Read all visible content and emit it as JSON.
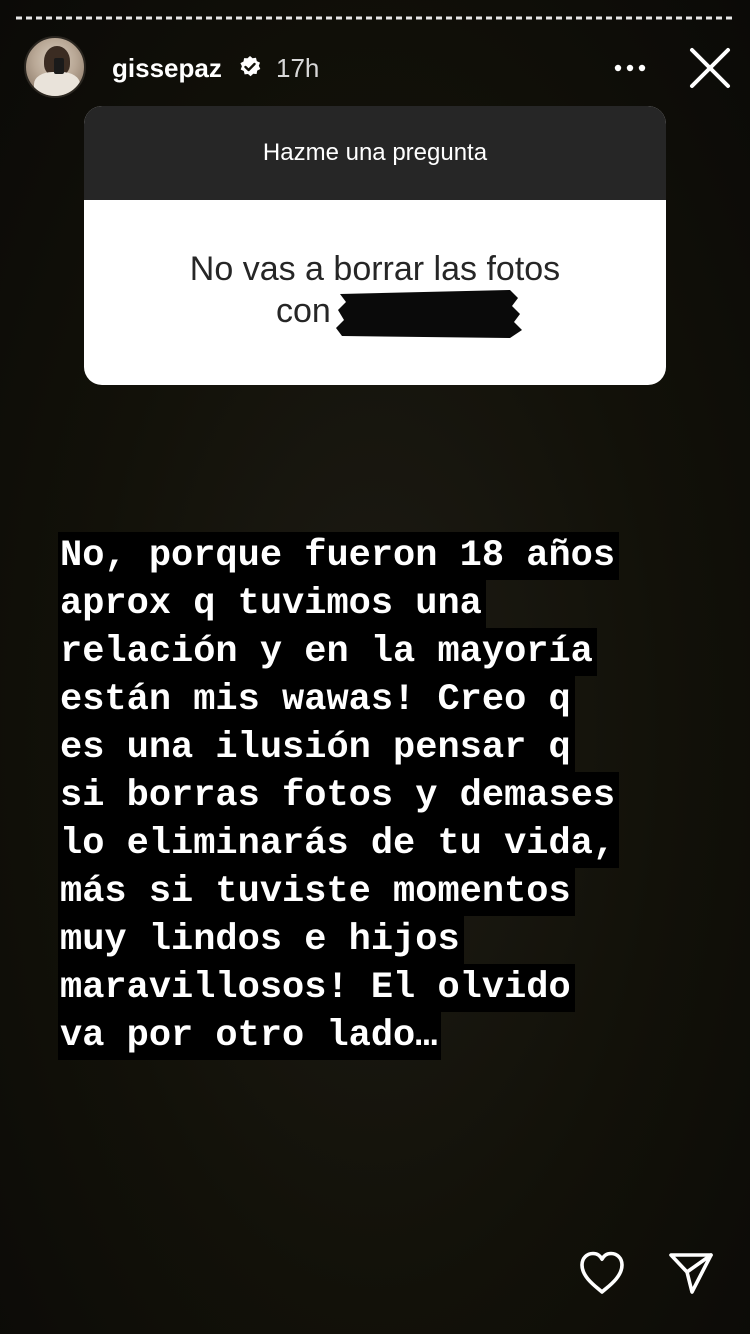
{
  "story": {
    "username": "gissepaz",
    "timestamp": "17h",
    "icons": {
      "avatar": "profile-photo",
      "verified": "verified-badge-icon",
      "more": "more-horizontal-icon",
      "close": "close-icon",
      "like": "heart-icon",
      "share": "send-icon"
    },
    "progress_segments": 1
  },
  "question_sticker": {
    "header": "Hazme una pregunta",
    "question_line1": "No vas a borrar las fotos",
    "question_line2": "con"
  },
  "reply": {
    "lines": [
      "No, porque fueron 18 años",
      "aprox q tuvimos una",
      "relación y en la mayoría",
      "están mis wawas! Creo q",
      "es una ilusión pensar q",
      "si borras fotos y demases",
      "lo eliminarás de tu vida,",
      "más si tuviste momentos",
      "muy lindos e hijos",
      "maravillosos! El olvido",
      "va por otro lado…"
    ]
  },
  "colors": {
    "background": "#121109",
    "sticker_header": "#262626",
    "text_highlight": "#000000"
  }
}
